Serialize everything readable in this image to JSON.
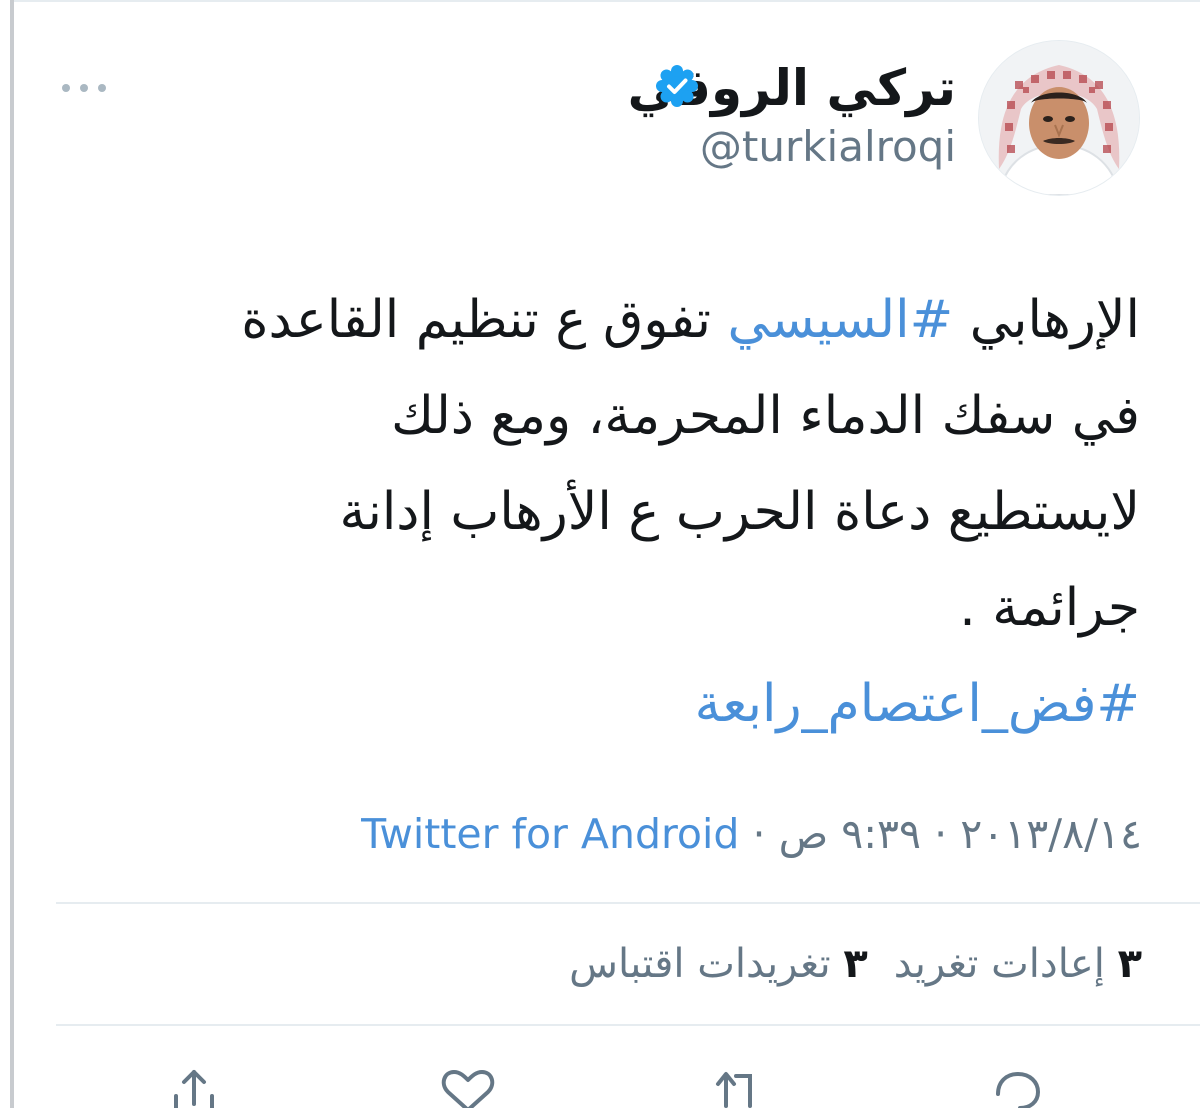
{
  "tweet": {
    "display_name": "تركي الروقي",
    "handle": "@turkialroqi",
    "verified": true,
    "text_lines": [
      [
        "الإرهابي ",
        "#السيسي",
        " تفوق ع تنظيم القاعدة"
      ],
      [
        "في سفك الدماء المحرمة، ومع ذلك"
      ],
      [
        "لايستطيع دعاة الحرب ع الأرهاب إدانة"
      ],
      [
        "جرائمة ."
      ]
    ],
    "hashtag_line": "#فض_اعتصام_رابعة",
    "date": "٢٠١٣/٨/١٤",
    "separator": "·",
    "time": "٩:٣٩ ص",
    "source": "Twitter for Android"
  },
  "stats": {
    "retweets_count": "٣",
    "retweets_label": "إعادات تغريد",
    "quotes_count": "٣",
    "quotes_label": "تغريدات اقتباس"
  },
  "actions": {
    "icons": [
      "reply-icon",
      "retweet-icon",
      "like-icon",
      "share-icon"
    ]
  },
  "colors": {
    "link": "#4a90d9",
    "secondary_text": "#657786",
    "verified_badge": "#1da1f2",
    "divider": "#e6ecf0"
  }
}
